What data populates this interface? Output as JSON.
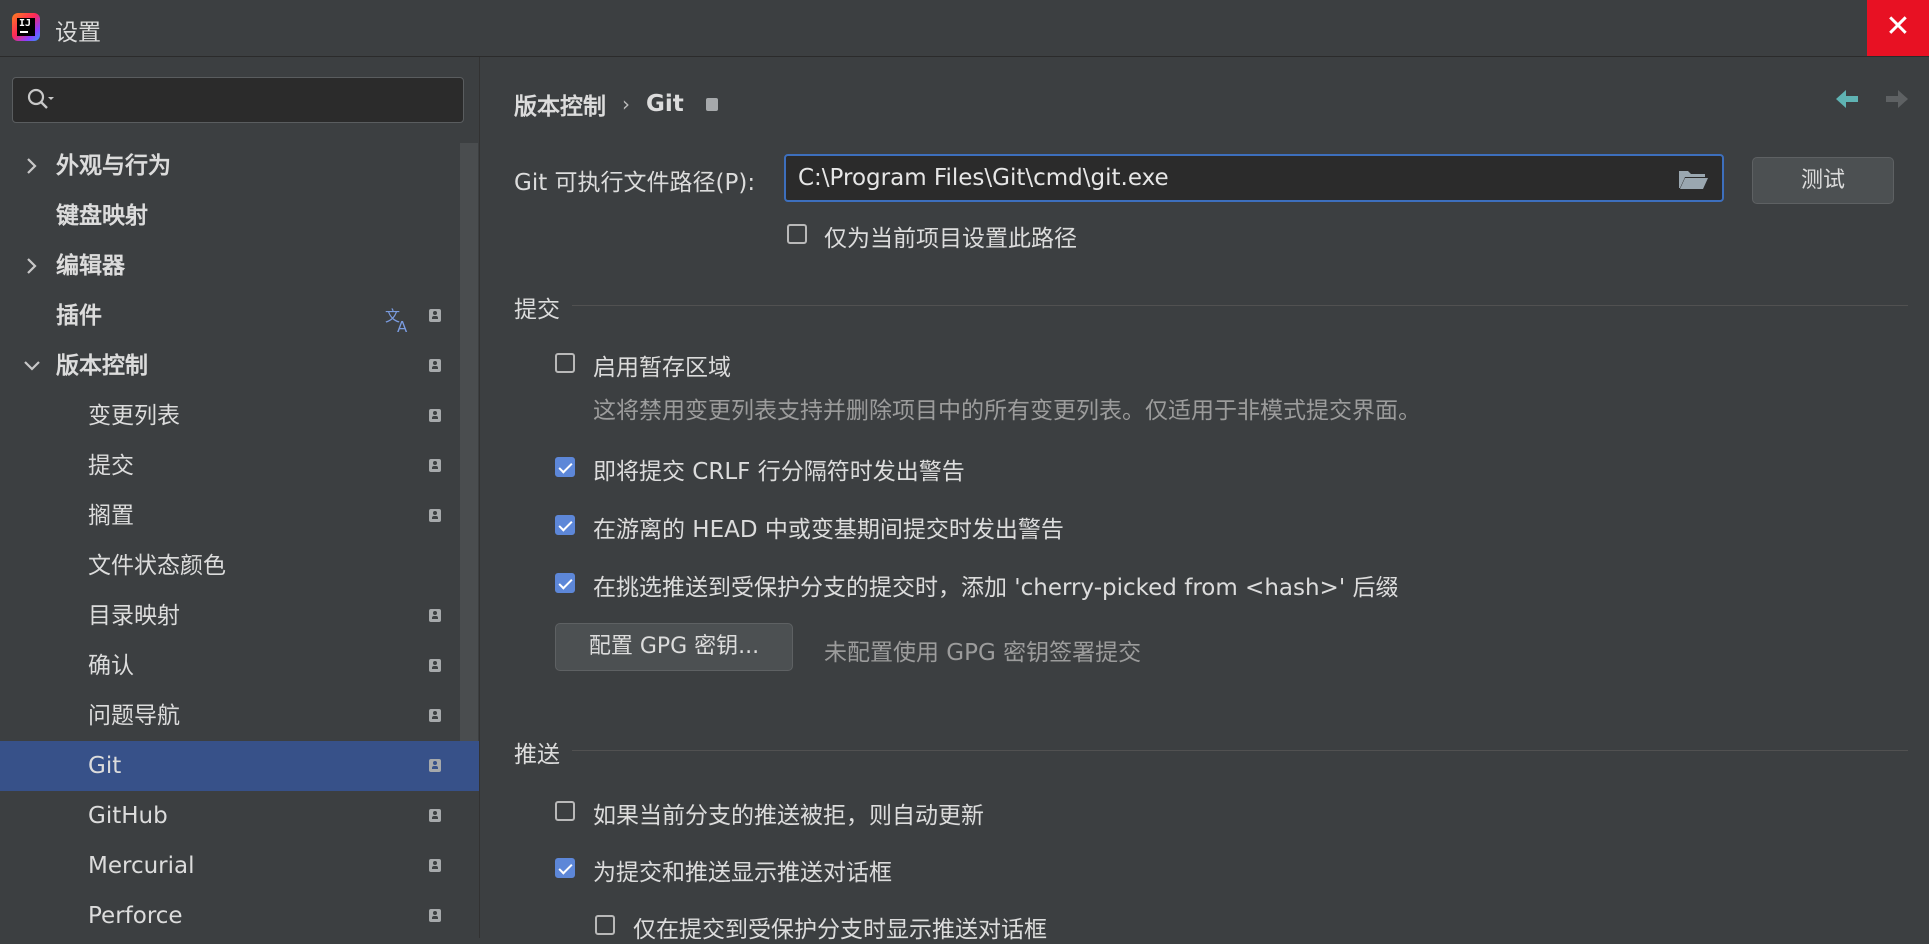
{
  "window": {
    "title": "设置",
    "close_glyph": "✕"
  },
  "sidebar": {
    "search_placeholder": "",
    "items": [
      {
        "label": "外观与行为",
        "level": 0,
        "chevron": "right"
      },
      {
        "label": "键盘映射",
        "level": 0
      },
      {
        "label": "编辑器",
        "level": 0,
        "chevron": "right"
      },
      {
        "label": "插件",
        "level": 0,
        "translate_icon": true,
        "badge": true
      },
      {
        "label": "版本控制",
        "level": 0,
        "chevron": "down",
        "badge": true
      },
      {
        "label": "变更列表",
        "level": 1,
        "badge": true
      },
      {
        "label": "提交",
        "level": 1,
        "badge": true
      },
      {
        "label": "搁置",
        "level": 1,
        "badge": true
      },
      {
        "label": "文件状态颜色",
        "level": 1
      },
      {
        "label": "目录映射",
        "level": 1,
        "badge": true
      },
      {
        "label": "确认",
        "level": 1,
        "badge": true
      },
      {
        "label": "问题导航",
        "level": 1,
        "badge": true
      },
      {
        "label": "Git",
        "level": 1,
        "badge": true,
        "selected": true
      },
      {
        "label": "GitHub",
        "level": 1,
        "badge": true
      },
      {
        "label": "Mercurial",
        "level": 1,
        "badge": true
      },
      {
        "label": "Perforce",
        "level": 1,
        "badge": true
      }
    ]
  },
  "breadcrumb": {
    "parent": "版本控制",
    "separator": "›",
    "current": "Git"
  },
  "git_path": {
    "label": "Git 可执行文件路径(P):",
    "value": "C:\\Program Files\\Git\\cmd\\git.exe",
    "test_button": "测试",
    "project_only_label": "仅为当前项目设置此路径",
    "project_only_checked": false
  },
  "commit_section": {
    "title": "提交",
    "staging_label": "启用暂存区域",
    "staging_checked": false,
    "staging_hint": "这将禁用变更列表支持并删除项目中的所有变更列表。仅适用于非模式提交界面。",
    "crlf_label": "即将提交 CRLF 行分隔符时发出警告",
    "crlf_checked": true,
    "detached_label": "在游离的 HEAD 中或变基期间提交时发出警告",
    "detached_checked": true,
    "cherry_label": "在挑选推送到受保护分支的提交时，添加 'cherry-picked from <hash>' 后缀",
    "cherry_checked": true,
    "gpg_button": "配置 GPG 密钥...",
    "gpg_hint": "未配置使用 GPG 密钥签署提交"
  },
  "push_section": {
    "title": "推送",
    "auto_update_label": "如果当前分支的推送被拒，则自动更新",
    "auto_update_checked": false,
    "show_dialog_label": "为提交和推送显示推送对话框",
    "show_dialog_checked": true,
    "protected_only_label": "仅在提交到受保护分支时显示推送对话框",
    "protected_only_checked": false
  },
  "colors": {
    "accent": "#5d87d8",
    "selection": "#375189",
    "close": "#e81123",
    "nav_arrow": "#5fb3b3"
  }
}
